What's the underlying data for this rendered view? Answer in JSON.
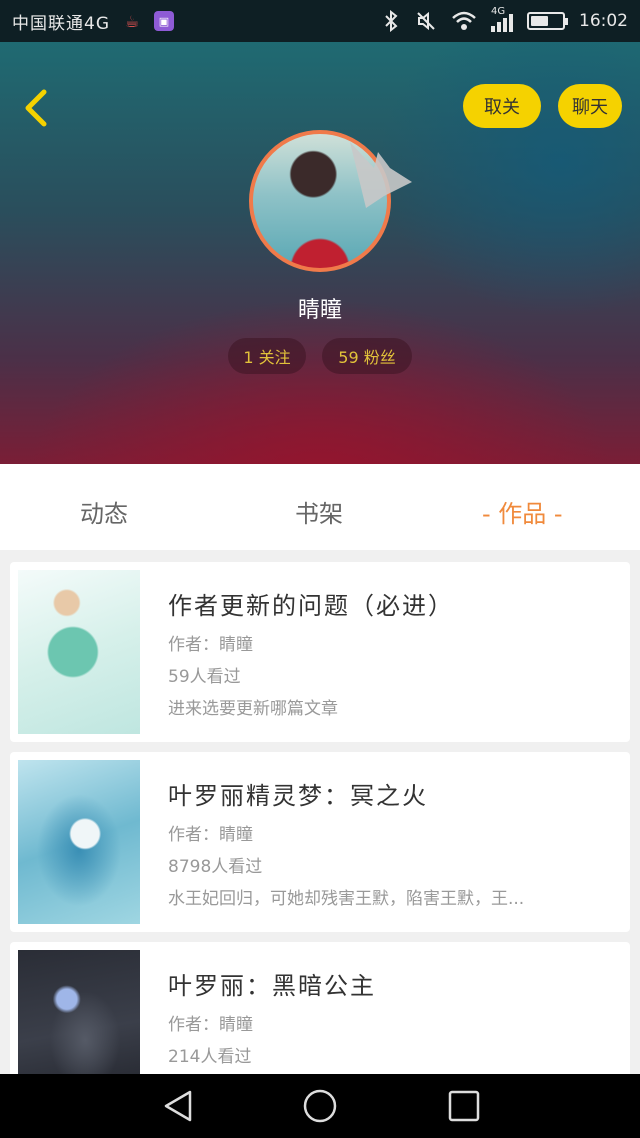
{
  "status_bar": {
    "carrier": "中国联通4G",
    "time": "16:02",
    "network": "4G",
    "battery_level": 0.55
  },
  "header": {
    "unfollow_label": "取关",
    "chat_label": "聊天",
    "username": "睛瞳",
    "follow_count_label": "1 关注",
    "fans_count_label": "59 粉丝"
  },
  "tabs": {
    "dynamics": "动态",
    "bookshelf": "书架",
    "works": "- 作品 -"
  },
  "works": [
    {
      "title": "作者更新的问题（必进）",
      "author": "作者：睛瞳",
      "views": "59人看过",
      "desc": "进来选要更新哪篇文章"
    },
    {
      "title": "叶罗丽精灵梦：冥之火",
      "author": "作者：睛瞳",
      "views": "8798人看过",
      "desc": "水王妃回归，可她却残害王默，陷害王默，王..."
    },
    {
      "title": "叶罗丽：黑暗公主",
      "author": "作者：睛瞳",
      "views": "214人看过",
      "desc": ""
    }
  ],
  "colors": {
    "accent_yellow": "#f5d200",
    "active_tab": "#f08a3c",
    "avatar_ring": "#f07a4a",
    "stat_text": "#e2c23a"
  },
  "icons": {
    "back": "chevron-left-icon",
    "crown": "crown-icon",
    "nav_back": "triangle-back-icon",
    "nav_home": "circle-home-icon",
    "nav_recent": "square-recent-icon"
  }
}
